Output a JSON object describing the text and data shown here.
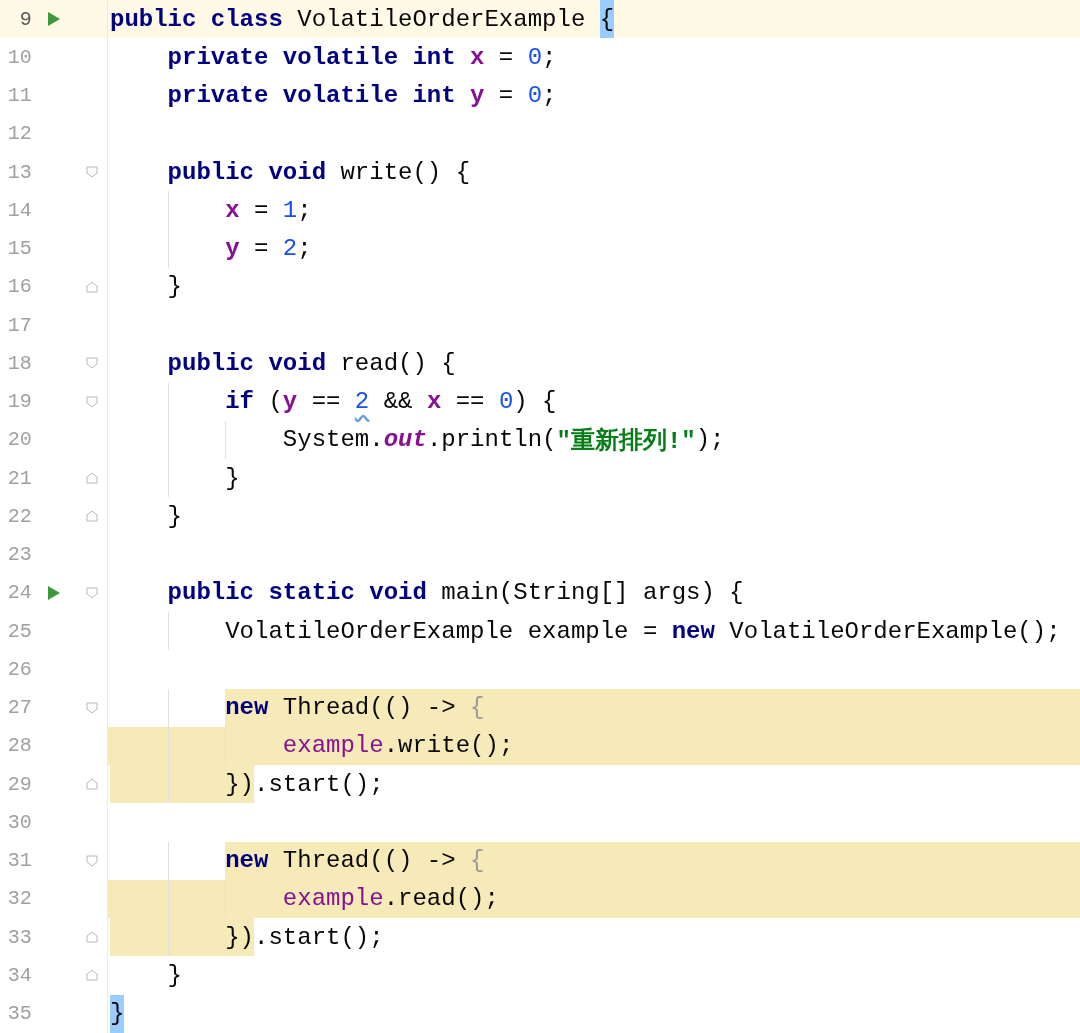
{
  "editor": {
    "lines": [
      {
        "number": "9",
        "kind": "plain",
        "run": true,
        "current": true,
        "fold_start": false,
        "fold_end": false,
        "tokens": [
          {
            "kind": "keyword",
            "text": "public class"
          },
          {
            "kind": "plain",
            "text": " VolatileOrderExample "
          },
          {
            "kind": "plain",
            "text": "{",
            "matched": true
          }
        ]
      },
      {
        "number": "10",
        "kind": "plain",
        "run": false,
        "current": false,
        "fold_start": false,
        "fold_end": false,
        "tokens": [
          {
            "kind": "keyword",
            "text": "    private volatile int "
          },
          {
            "kind": "field",
            "text": "x"
          },
          {
            "kind": "plain",
            "text": " = "
          },
          {
            "kind": "number",
            "text": "0"
          },
          {
            "kind": "plain",
            "text": ";"
          }
        ]
      },
      {
        "number": "11",
        "kind": "plain",
        "run": false,
        "current": false,
        "fold_start": false,
        "fold_end": false,
        "tokens": [
          {
            "kind": "keyword",
            "text": "    private volatile int "
          },
          {
            "kind": "field",
            "text": "y"
          },
          {
            "kind": "plain",
            "text": " = "
          },
          {
            "kind": "number",
            "text": "0"
          },
          {
            "kind": "plain",
            "text": ";"
          }
        ]
      },
      {
        "number": "12",
        "kind": "plain",
        "run": false,
        "current": false,
        "fold_start": false,
        "fold_end": false
      },
      {
        "number": "13",
        "kind": "plain",
        "run": false,
        "current": false,
        "fold_start": true,
        "fold_end": false,
        "tokens": [
          {
            "kind": "keyword",
            "text": "    public void"
          },
          {
            "kind": "plain",
            "text": " write() {"
          }
        ]
      },
      {
        "number": "14",
        "kind": "plain",
        "run": false,
        "current": false,
        "fold_start": false,
        "fold_end": false,
        "tokens": [
          {
            "kind": "field",
            "text": "        x"
          },
          {
            "kind": "plain",
            "text": " = "
          },
          {
            "kind": "number",
            "text": "1"
          },
          {
            "kind": "plain",
            "text": ";"
          }
        ]
      },
      {
        "number": "15",
        "kind": "plain",
        "run": false,
        "current": false,
        "fold_start": false,
        "fold_end": false,
        "tokens": [
          {
            "kind": "field",
            "text": "        y"
          },
          {
            "kind": "plain",
            "text": " = "
          },
          {
            "kind": "number",
            "text": "2"
          },
          {
            "kind": "plain",
            "text": ";"
          }
        ]
      },
      {
        "number": "16",
        "kind": "plain",
        "run": false,
        "current": false,
        "fold_start": false,
        "fold_end": true,
        "tokens": [
          {
            "kind": "plain",
            "text": "    }"
          }
        ]
      },
      {
        "number": "17",
        "kind": "plain",
        "run": false,
        "current": false,
        "fold_start": false,
        "fold_end": false
      },
      {
        "number": "18",
        "kind": "plain",
        "run": false,
        "current": false,
        "fold_start": true,
        "fold_end": false,
        "tokens": [
          {
            "kind": "keyword",
            "text": "    public void"
          },
          {
            "kind": "plain",
            "text": " read() {"
          }
        ]
      },
      {
        "number": "19",
        "kind": "plain",
        "run": false,
        "current": false,
        "fold_start": true,
        "fold_end": false,
        "tokens": [
          {
            "kind": "keyword",
            "text": "        if"
          },
          {
            "kind": "plain",
            "text": " ("
          },
          {
            "kind": "field",
            "text": "y"
          },
          {
            "kind": "plain",
            "text": " == "
          },
          {
            "kind": "number",
            "text": "2",
            "warning": true
          },
          {
            "kind": "plain",
            "text": " && "
          },
          {
            "kind": "field",
            "text": "x"
          },
          {
            "kind": "plain",
            "text": " == "
          },
          {
            "kind": "number",
            "text": "0"
          },
          {
            "kind": "plain",
            "text": ") {"
          }
        ]
      },
      {
        "number": "20",
        "kind": "plain",
        "run": false,
        "current": false,
        "fold_start": false,
        "fold_end": false,
        "tokens": [
          {
            "kind": "plain",
            "text": "            System."
          },
          {
            "kind": "static",
            "text": "out"
          },
          {
            "kind": "plain",
            "text": ".println("
          },
          {
            "kind": "string",
            "text": "\"重新排列!\""
          },
          {
            "kind": "plain",
            "text": ");"
          }
        ]
      },
      {
        "number": "21",
        "kind": "plain",
        "run": false,
        "current": false,
        "fold_start": false,
        "fold_end": true,
        "tokens": [
          {
            "kind": "plain",
            "text": "        }"
          }
        ]
      },
      {
        "number": "22",
        "kind": "plain",
        "run": false,
        "current": false,
        "fold_start": false,
        "fold_end": true,
        "tokens": [
          {
            "kind": "plain",
            "text": "    }"
          }
        ]
      },
      {
        "number": "23",
        "kind": "plain",
        "run": false,
        "current": false,
        "fold_start": false,
        "fold_end": false
      },
      {
        "number": "24",
        "kind": "plain",
        "run": true,
        "current": false,
        "fold_start": true,
        "fold_end": false,
        "tokens": [
          {
            "kind": "keyword",
            "text": "    public static void"
          },
          {
            "kind": "plain",
            "text": " main(String[] args) {"
          }
        ]
      },
      {
        "number": "25",
        "kind": "plain",
        "run": false,
        "current": false,
        "fold_start": false,
        "fold_end": false,
        "tokens": [
          {
            "kind": "plain",
            "text": "        VolatileOrderExample example = "
          },
          {
            "kind": "keyword",
            "text": "new"
          },
          {
            "kind": "plain",
            "text": " VolatileOrderExample();"
          }
        ]
      },
      {
        "number": "26",
        "kind": "plain",
        "run": false,
        "current": false,
        "fold_start": false,
        "fold_end": false
      },
      {
        "number": "27",
        "kind": "highlight-tail",
        "run": false,
        "current": false,
        "fold_start": true,
        "fold_end": false,
        "tokens": [
          {
            "kind": "keyword",
            "text": "        new"
          },
          {
            "kind": "plain",
            "text": " Thread(() -> "
          },
          {
            "kind": "lambda",
            "text": "{"
          }
        ]
      },
      {
        "number": "28",
        "kind": "highlight-full",
        "run": false,
        "current": false,
        "fold_start": false,
        "fold_end": false,
        "tokens": [
          {
            "kind": "captured",
            "text": "            example"
          },
          {
            "kind": "plain",
            "text": ".write();"
          }
        ]
      },
      {
        "number": "29",
        "kind": "highlight-head",
        "run": false,
        "current": false,
        "fold_start": false,
        "fold_end": true,
        "tokens": [
          {
            "kind": "plain",
            "text": "        })"
          },
          {
            "kind": "plain",
            "text": ".start();"
          }
        ]
      },
      {
        "number": "30",
        "kind": "plain",
        "run": false,
        "current": false,
        "fold_start": false,
        "fold_end": false
      },
      {
        "number": "31",
        "kind": "highlight-tail",
        "run": false,
        "current": false,
        "fold_start": true,
        "fold_end": false,
        "tokens": [
          {
            "kind": "keyword",
            "text": "        new"
          },
          {
            "kind": "plain",
            "text": " Thread(() -> "
          },
          {
            "kind": "lambda",
            "text": "{"
          }
        ]
      },
      {
        "number": "32",
        "kind": "highlight-full",
        "run": false,
        "current": false,
        "fold_start": false,
        "fold_end": false,
        "tokens": [
          {
            "kind": "captured",
            "text": "            example"
          },
          {
            "kind": "plain",
            "text": ".read();"
          }
        ]
      },
      {
        "number": "33",
        "kind": "highlight-head",
        "run": false,
        "current": false,
        "fold_start": false,
        "fold_end": true,
        "tokens": [
          {
            "kind": "plain",
            "text": "        })"
          },
          {
            "kind": "plain",
            "text": ".start();"
          }
        ]
      },
      {
        "number": "34",
        "kind": "plain",
        "run": false,
        "current": false,
        "fold_start": false,
        "fold_end": true,
        "tokens": [
          {
            "kind": "plain",
            "text": "    }"
          }
        ]
      },
      {
        "number": "35",
        "kind": "plain",
        "run": false,
        "current": false,
        "fold_start": false,
        "fold_end": false,
        "tokens": [
          {
            "kind": "plain",
            "text": "}",
            "matched": true
          }
        ]
      }
    ]
  }
}
